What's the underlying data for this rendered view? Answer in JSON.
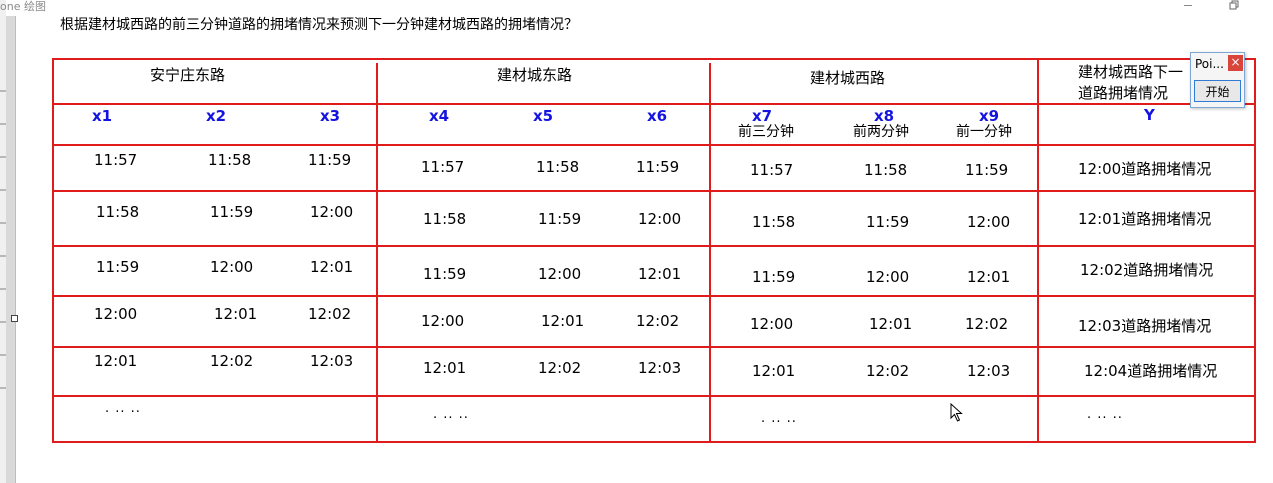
{
  "window": {
    "title": "one 绘图"
  },
  "question": "根据建材城西路的前三分钟道路的拥堵情况来预测下一分钟建材城西路的拥堵情况？",
  "groups": [
    "安宁庄东路",
    "建材城东路",
    "建材城西路",
    "建材城西路下一",
    "道路拥堵情况"
  ],
  "vars": [
    "x1",
    "x2",
    "x3",
    "x4",
    "x5",
    "x6",
    "x7",
    "x8",
    "x9",
    "Y"
  ],
  "var_subs": [
    "前三分钟",
    "前两分钟",
    "前一分钟"
  ],
  "rows": [
    [
      "11:57",
      "11:58",
      "11:59",
      "11:57",
      "11:58",
      "11:59",
      "11:57",
      "11:58",
      "11:59",
      "12:00道路拥堵情况"
    ],
    [
      "11:58",
      "11:59",
      "12:00",
      "11:58",
      "11:59",
      "12:00",
      "11:58",
      "11:59",
      "12:00",
      "12:01道路拥堵情况"
    ],
    [
      "11:59",
      "12:00",
      "12:01",
      "11:59",
      "12:00",
      "12:01",
      "11:59",
      "12:00",
      "12:01",
      "12:02道路拥堵情况"
    ],
    [
      "12:00",
      "12:01",
      "12:02",
      "12:00",
      "12:01",
      "12:02",
      "12:00",
      "12:01",
      "12:02",
      "12:03道路拥堵情况"
    ],
    [
      "12:01",
      "12:02",
      "12:03",
      "12:01",
      "12:02",
      "12:03",
      "12:01",
      "12:02",
      "12:03",
      "12:04道路拥堵情况"
    ]
  ],
  "ellipsis": [
    ". .. ..",
    ". .. ..",
    ". .. ..",
    ". .. .."
  ],
  "popup": {
    "title": "Poi...",
    "close": "×",
    "button": "开始"
  },
  "colors": {
    "grid": "#e01b1b",
    "var": "#1414e0"
  }
}
